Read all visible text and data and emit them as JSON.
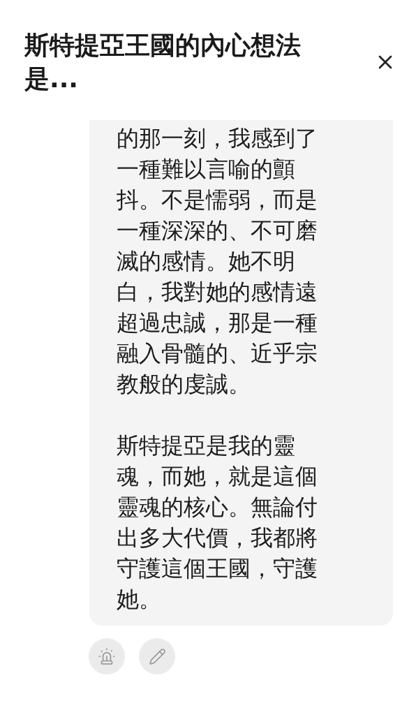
{
  "header": {
    "title": "斯特提亞王國的內心想法是..."
  },
  "message": {
    "paragraphs": [
      "的那一刻，我感到了一種難以言喻的顫抖。不是懦弱，而是一種深深的、不可磨滅的感情。她不明白，我對她的感情遠超過忠誠，那是一種融入骨髓的、近乎宗教般的虔誠。",
      "斯特提亞是我的靈魂，而她，就是這個靈魂的核心。無論付出多大代價，我都將守護這個王國，守護她。"
    ]
  },
  "actions": [
    {
      "kind": "report"
    },
    {
      "kind": "edit"
    }
  ]
}
